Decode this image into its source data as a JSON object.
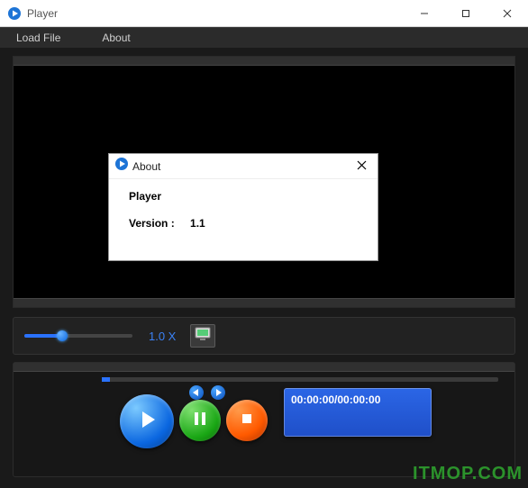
{
  "window": {
    "title": "Player"
  },
  "menu": {
    "load_file": "Load File",
    "about": "About"
  },
  "speed": {
    "label": "1.0 X",
    "fill_percent": 35
  },
  "progress": {
    "fill_percent": 2
  },
  "time": {
    "display": "00:00:00/00:00:00"
  },
  "about_dialog": {
    "title": "About",
    "product_name": "Player",
    "version_label": "Version :",
    "version_value": "1.1"
  },
  "watermark": {
    "text": "ITMOP.COM"
  },
  "icons": {
    "app": "play-circle",
    "export": "screen-export",
    "prev": "triangle-left",
    "next": "triangle-right",
    "play": "triangle-right",
    "pause": "pause-bars",
    "stop": "square",
    "minimize": "minimize",
    "maximize": "maximize",
    "close": "close"
  }
}
